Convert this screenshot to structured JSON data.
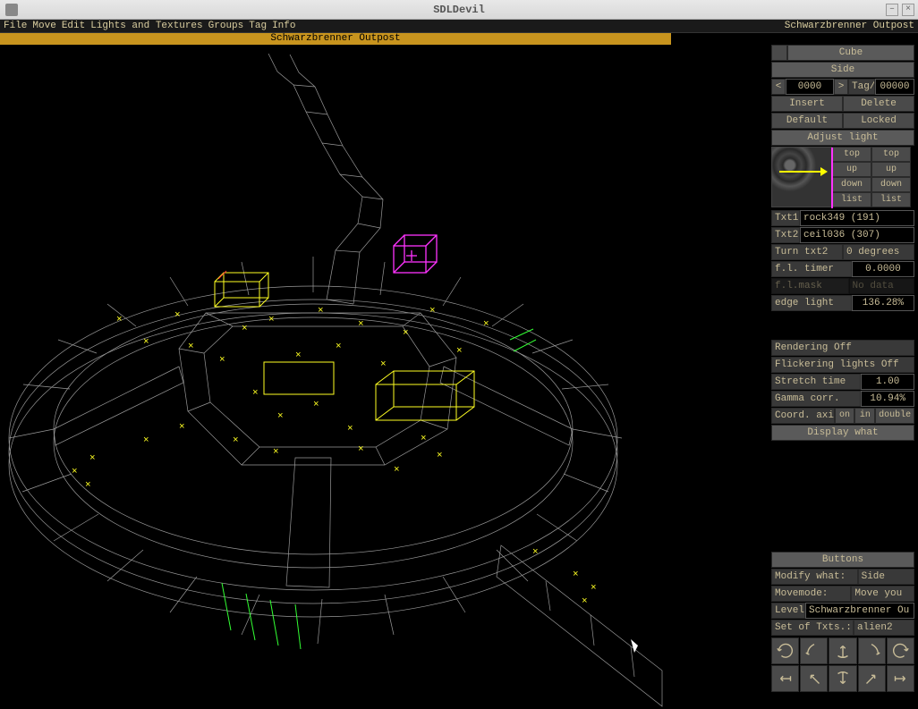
{
  "window": {
    "title": "SDLDevil"
  },
  "menu": {
    "items": [
      "File",
      "Move",
      "Edit",
      "Lights and Textures",
      "Groups",
      "Tag",
      "Info"
    ],
    "level": "Schwarzbrenner Outpost"
  },
  "viewport": {
    "title": "Schwarzbrenner Outpost"
  },
  "side_panel": {
    "header_left": "Cube",
    "header_right": "Side",
    "nav": {
      "prev": "<",
      "value": "0000",
      "next": ">",
      "tag_label": "Tag/",
      "tag_value": "00000"
    },
    "btns": {
      "insert": "Insert",
      "delete": "Delete",
      "default": "Default",
      "locked": "Locked"
    },
    "adjust": "Adjust light",
    "orient": {
      "top": "top",
      "up": "up",
      "down": "down",
      "list": "list"
    },
    "txt1": {
      "label": "Txt1",
      "value": "rock349 (191)"
    },
    "txt2": {
      "label": "Txt2",
      "value": "ceil036 (307)"
    },
    "turn": {
      "label": "Turn txt2",
      "value": "0 degrees"
    },
    "fl_timer": {
      "label": "f.l. timer",
      "value": "0.0000"
    },
    "fl_mask": {
      "label": "f.l.mask",
      "value": "No data"
    },
    "edge_light": {
      "label": "edge light",
      "value": "136.28%"
    }
  },
  "render_panel": {
    "rendering": "Rendering Off",
    "flickering": "Flickering lights Off",
    "stretch": {
      "label": "Stretch time",
      "value": "1.00"
    },
    "gamma": {
      "label": "Gamma corr.",
      "value": "10.94%"
    },
    "coord": {
      "label": "Coord. axis",
      "opts": [
        "on",
        "in",
        "double"
      ]
    },
    "display": "Display what"
  },
  "bottom_panel": {
    "header": "Buttons",
    "modify": {
      "label": "Modify what:",
      "value": "Side"
    },
    "movemode": {
      "label": "Movemode:",
      "value": "Move you"
    },
    "level": {
      "label": "Level",
      "value": "Schwarzbrenner Ou"
    },
    "txts": {
      "label": "Set of Txts.:",
      "value": "alien2"
    }
  },
  "icons": {
    "rotate-ccw": "rotate-ccw",
    "rotate-cw": "rotate-cw",
    "tilt-left": "tilt-left",
    "tilt-right": "tilt-right",
    "rotate-ccw2": "rotate-ccw2",
    "pan-left": "pan-left",
    "pan-up": "pan-up",
    "pan-down": "pan-down",
    "pan-right": "pan-right",
    "pan-out": "pan-out"
  }
}
